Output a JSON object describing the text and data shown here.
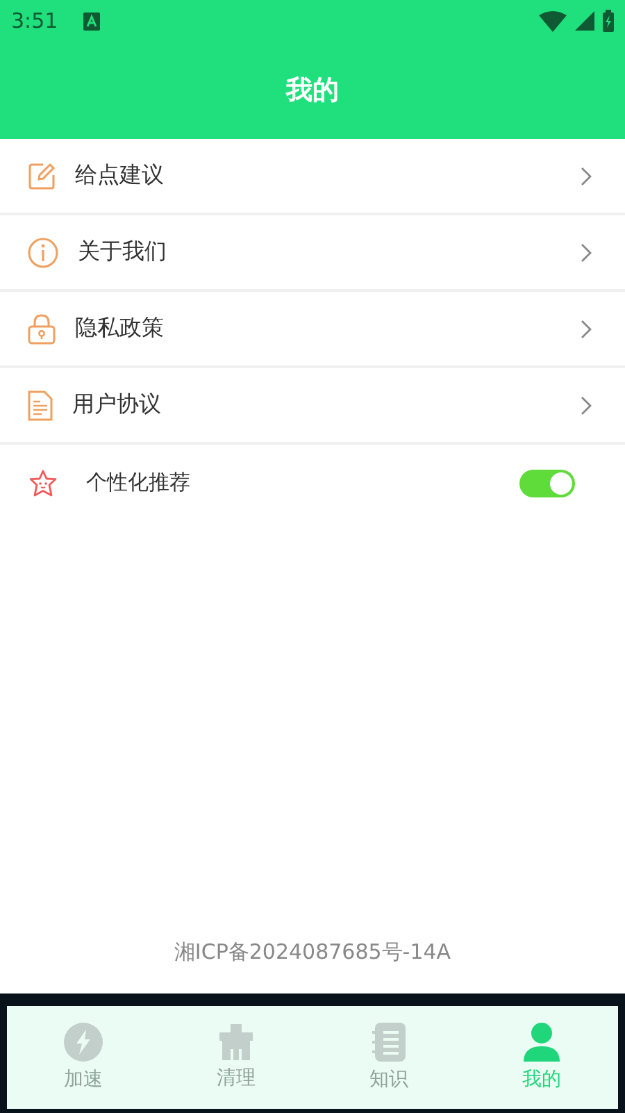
{
  "status_bar": {
    "time": "3:51"
  },
  "header": {
    "title": "我的"
  },
  "menu": [
    {
      "kind": "link",
      "label": "给点建议"
    },
    {
      "kind": "link",
      "label": "关于我们"
    },
    {
      "kind": "link",
      "label": "隐私政策"
    },
    {
      "kind": "link",
      "label": "用户协议"
    },
    {
      "kind": "toggle",
      "label": "个性化推荐",
      "on": true
    }
  ],
  "footer": {
    "icp": "湘ICP备2024087685号-14A"
  },
  "tabs": [
    {
      "label": "加速",
      "selected": false
    },
    {
      "label": "清理",
      "selected": false
    },
    {
      "label": "知识",
      "selected": false
    },
    {
      "label": "我的",
      "selected": true
    }
  ]
}
